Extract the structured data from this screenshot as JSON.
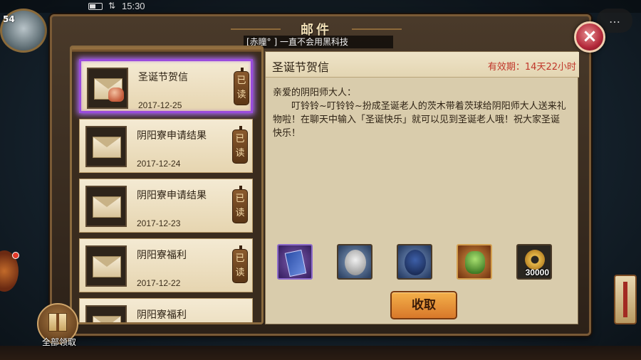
{
  "status_bar": {
    "time": "15:30",
    "signal_icon": "⇅"
  },
  "background": {
    "player_level": "54",
    "chat_icon": "…"
  },
  "panel": {
    "title": "邮件",
    "close_icon": "×"
  },
  "notice": {
    "text": "[赤瞳° ] 一直不会用黑科技"
  },
  "mail_list": [
    {
      "subject": "圣诞节贺信",
      "date": "2017-12-25",
      "status": "已读",
      "selected": true,
      "has_gift": true
    },
    {
      "subject": "阴阳寮申请结果",
      "date": "2017-12-24",
      "status": "已读",
      "selected": false,
      "has_gift": false
    },
    {
      "subject": "阴阳寮申请结果",
      "date": "2017-12-23",
      "status": "已读",
      "selected": false,
      "has_gift": false
    },
    {
      "subject": "阴阳寮福利",
      "date": "2017-12-22",
      "status": "已读",
      "selected": false,
      "has_gift": false
    },
    {
      "subject": "阴阳寮福利",
      "date": "",
      "status": "",
      "selected": false,
      "has_gift": false
    }
  ],
  "detail": {
    "title": "圣诞节贺信",
    "expiry": "有效期：14天22小时",
    "greeting": "亲爱的阴阳师大人：",
    "body": "叮铃铃~叮铃铃~扮成圣诞老人的茨木带着茨球给阴阳师大人送来礼物啦！在聊天中输入「圣诞快乐」就可以见到圣诞老人哦！祝大家圣诞快乐！",
    "rewards": [
      {
        "icon": "book-icon",
        "qty": ""
      },
      {
        "icon": "white-daruma-icon",
        "qty": ""
      },
      {
        "icon": "blue-daruma-icon",
        "qty": ""
      },
      {
        "icon": "character-material-icon",
        "qty": ""
      },
      {
        "icon": "gold-coin-icon",
        "qty": "30000"
      }
    ],
    "claim_label": "收取"
  },
  "claim_all": {
    "label": "全部领取"
  },
  "colors": {
    "selected_border": "#9a4bdc",
    "expiry_red": "#c0362a",
    "button_orange": "#e8923a"
  }
}
